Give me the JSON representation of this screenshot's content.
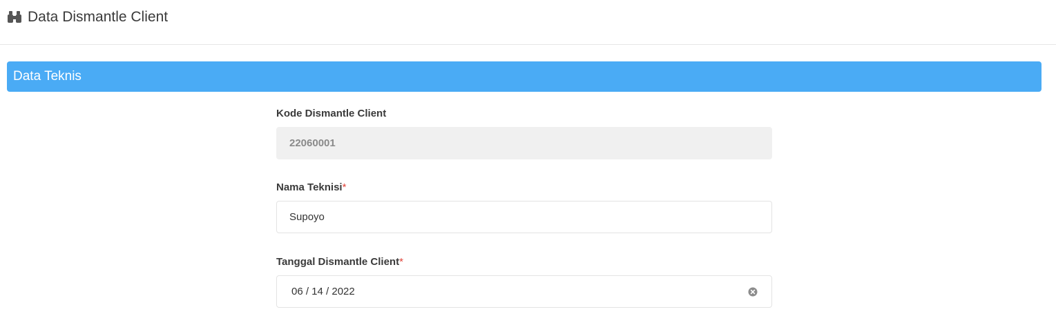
{
  "header": {
    "title": "Data Dismantle Client",
    "icon": "binoculars-icon"
  },
  "section": {
    "title": "Data Teknis",
    "color": "#4aabf5"
  },
  "form": {
    "kode": {
      "label": "Kode Dismantle Client",
      "value": "22060001"
    },
    "nama_teknisi": {
      "label": "Nama Teknisi",
      "required_mark": "*",
      "value": "Supoyo"
    },
    "tanggal": {
      "label": "Tanggal Dismantle Client",
      "required_mark": "*",
      "value": "06 / 14 / 2022",
      "clear_icon": "clear-circle-icon"
    }
  }
}
